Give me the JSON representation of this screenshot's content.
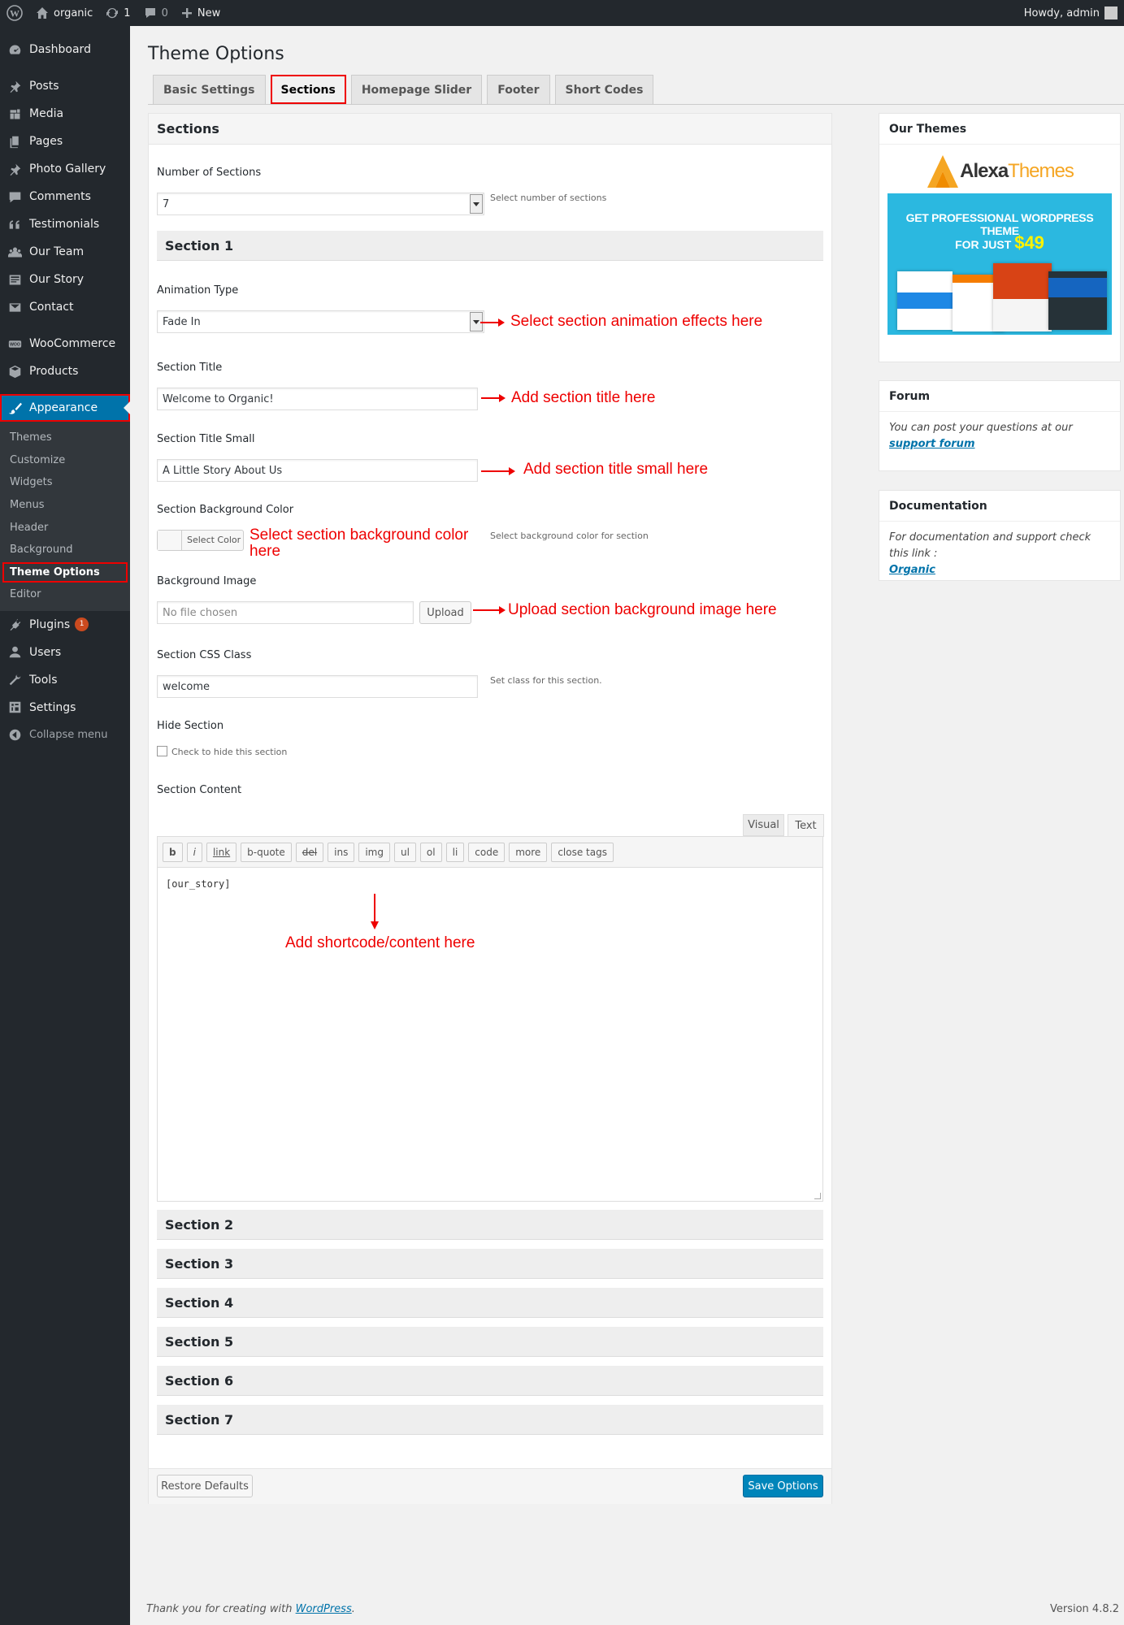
{
  "adminbar": {
    "site_name": "organic",
    "updates_count": "1",
    "comments_count": "0",
    "new_label": "New",
    "greeting": "Howdy, admin"
  },
  "sidebar": {
    "items": [
      {
        "label": "Dashboard"
      },
      {
        "label": "Posts"
      },
      {
        "label": "Media"
      },
      {
        "label": "Pages"
      },
      {
        "label": "Photo Gallery"
      },
      {
        "label": "Comments"
      },
      {
        "label": "Testimonials"
      },
      {
        "label": "Our Team"
      },
      {
        "label": "Our Story"
      },
      {
        "label": "Contact"
      },
      {
        "label": "WooCommerce"
      },
      {
        "label": "Products"
      },
      {
        "label": "Appearance"
      },
      {
        "label": "Plugins",
        "badge": "1"
      },
      {
        "label": "Users"
      },
      {
        "label": "Tools"
      },
      {
        "label": "Settings"
      },
      {
        "label": "Collapse menu"
      }
    ],
    "submenu": [
      "Themes",
      "Customize",
      "Widgets",
      "Menus",
      "Header",
      "Background",
      "Theme Options",
      "Editor"
    ]
  },
  "page": {
    "title": "Theme Options",
    "tabs": [
      "Basic Settings",
      "Sections",
      "Homepage Slider",
      "Footer",
      "Short Codes"
    ],
    "panel_title": "Sections"
  },
  "form": {
    "num_sections_label": "Number of Sections",
    "num_sections_value": "7",
    "num_sections_help": "Select number of sections",
    "section1_title": "Section 1",
    "animation_label": "Animation Type",
    "animation_value": "Fade In",
    "title_label": "Section Title",
    "title_value": "Welcome to Organic!",
    "title_small_label": "Section Title Small",
    "title_small_value": "A Little Story About Us",
    "bg_color_label": "Section Background Color",
    "select_color_btn": "Select Color",
    "bg_color_help": "Select background color for section",
    "bg_image_label": "Background Image",
    "bg_image_placeholder": "No file chosen",
    "upload_btn": "Upload",
    "css_class_label": "Section CSS Class",
    "css_class_value": "welcome",
    "css_class_help": "Set class for this section.",
    "hide_label": "Hide Section",
    "hide_check_label": "Check to hide this section",
    "content_label": "Section Content",
    "editor_tabs": [
      "Visual",
      "Text"
    ],
    "quicktags": [
      "b",
      "i",
      "link",
      "b-quote",
      "del",
      "ins",
      "img",
      "ul",
      "ol",
      "li",
      "code",
      "more",
      "close tags"
    ],
    "content_value": "[our_story]",
    "other_sections": [
      "Section 2",
      "Section 3",
      "Section 4",
      "Section 5",
      "Section 6",
      "Section 7"
    ],
    "restore_btn": "Restore Defaults",
    "save_btn": "Save Options"
  },
  "annotations": {
    "animation": "Select section animation effects here",
    "title": "Add section title here",
    "title_small": "Add section title small here",
    "bg_color": "Select section background color here",
    "bg_image": "Upload section background image here",
    "content": "Add shortcode/content here"
  },
  "right": {
    "themes_title": "Our Themes",
    "brand_alexa": "Alexa",
    "brand_themes": "Themes",
    "promo_line1": "GET PROFESSIONAL WORDPRESS THEME",
    "promo_line2": "FOR JUST",
    "promo_price": "$49",
    "forum_title": "Forum",
    "forum_text": "You can post your questions at our",
    "forum_link": "support forum",
    "doc_title": "Documentation",
    "doc_text": "For documentation and support check this link :",
    "doc_link": "Organic"
  },
  "footer": {
    "thanks_prefix": "Thank you for creating with",
    "thanks_link": "WordPress",
    "thanks_suffix": ".",
    "version": "Version 4.8.2"
  },
  "colors": {
    "accent": "#0073aa",
    "annotation": "#e00000",
    "sidebar_bg": "#23282d"
  }
}
